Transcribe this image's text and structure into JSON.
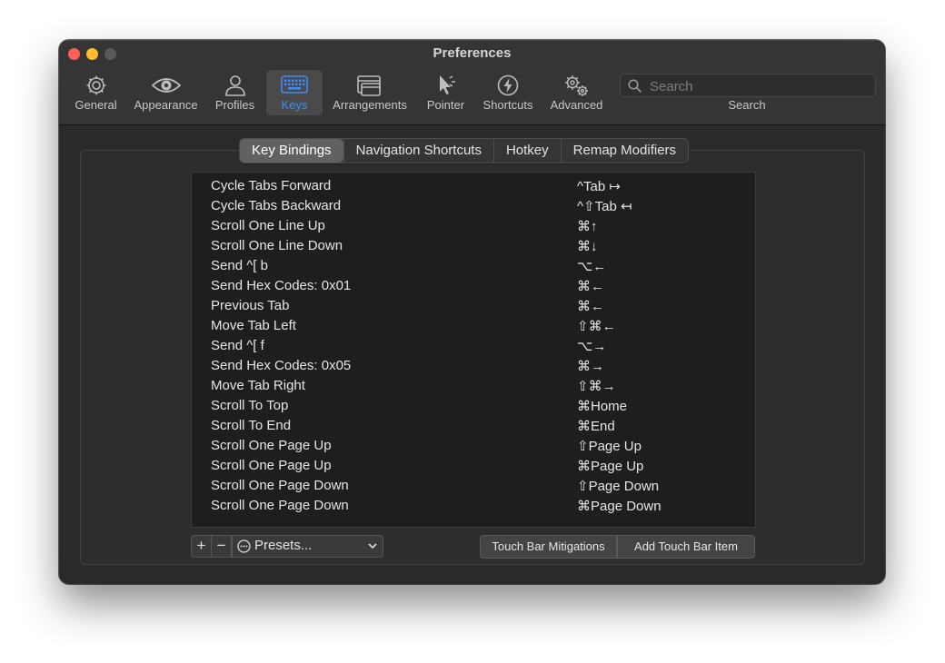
{
  "window": {
    "title": "Preferences"
  },
  "toolbar": {
    "items": [
      {
        "label": "General",
        "icon": "gear-icon"
      },
      {
        "label": "Appearance",
        "icon": "eye-icon"
      },
      {
        "label": "Profiles",
        "icon": "person-icon"
      },
      {
        "label": "Keys",
        "icon": "keyboard-icon",
        "active": true
      },
      {
        "label": "Arrangements",
        "icon": "windows-icon"
      },
      {
        "label": "Pointer",
        "icon": "pointer-icon"
      },
      {
        "label": "Shortcuts",
        "icon": "bolt-icon"
      },
      {
        "label": "Advanced",
        "icon": "gears-icon"
      }
    ],
    "search_placeholder": "Search",
    "search_label": "Search",
    "accent": "#3b8ef5"
  },
  "tabs": [
    "Key Bindings",
    "Navigation Shortcuts",
    "Hotkey",
    "Remap Modifiers"
  ],
  "selected_tab": "Key Bindings",
  "bindings": [
    {
      "action": "Cycle Tabs Forward",
      "combo": "^Tab ↦"
    },
    {
      "action": "Cycle Tabs Backward",
      "combo": "^⇧Tab ↤"
    },
    {
      "action": "Scroll One Line Up",
      "combo": "⌘↑"
    },
    {
      "action": "Scroll One Line Down",
      "combo": "⌘↓"
    },
    {
      "action": "Send ^[ b",
      "combo": "⌥←"
    },
    {
      "action": "Send Hex Codes: 0x01",
      "combo": "⌘←"
    },
    {
      "action": "Previous Tab",
      "combo": "⌘←"
    },
    {
      "action": "Move Tab Left",
      "combo": "⇧⌘←"
    },
    {
      "action": "Send ^[ f",
      "combo": "⌥→"
    },
    {
      "action": "Send Hex Codes: 0x05",
      "combo": "⌘→"
    },
    {
      "action": "Move Tab Right",
      "combo": "⇧⌘→"
    },
    {
      "action": "Scroll To Top",
      "combo": "⌘Home"
    },
    {
      "action": "Scroll To End",
      "combo": "⌘End"
    },
    {
      "action": "Scroll One Page Up",
      "combo": "⇧Page Up"
    },
    {
      "action": "Scroll One Page Up",
      "combo": "⌘Page Up"
    },
    {
      "action": "Scroll One Page Down",
      "combo": "⇧Page Down"
    },
    {
      "action": "Scroll One Page Down",
      "combo": "⌘Page Down"
    }
  ],
  "bottom": {
    "add_label": "+",
    "remove_label": "−",
    "presets_label": "Presets...",
    "touch_bar_mitigations": "Touch Bar Mitigations",
    "add_touch_bar_item": "Add Touch Bar Item"
  }
}
